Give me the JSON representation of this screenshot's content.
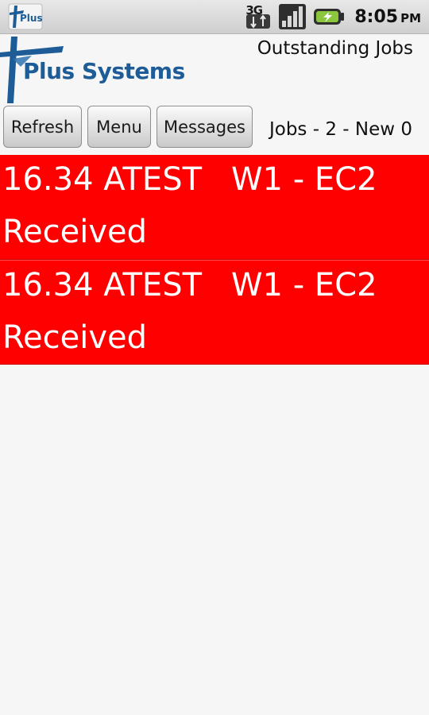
{
  "status_bar": {
    "notification_icon_text": "Plus",
    "network_type": "3G",
    "time": "8:05",
    "ampm": "PM",
    "icons": [
      "plus-notification-icon",
      "3g-data-icon",
      "signal-strength-icon",
      "battery-charging-icon"
    ]
  },
  "header": {
    "logo_text": "Plus Systems",
    "screen_title": "Outstanding Jobs"
  },
  "toolbar": {
    "refresh_label": "Refresh",
    "menu_label": "Menu",
    "messages_label": "Messages",
    "jobs_summary": "Jobs - 2 - New 0"
  },
  "jobs": [
    {
      "id_name": "16.34 ATEST",
      "route": "W1 - EC2",
      "status": "Received"
    },
    {
      "id_name": "16.34 ATEST",
      "route": "W1 - EC2",
      "status": "Received"
    }
  ],
  "colors": {
    "job_row_background": "#fe0000",
    "job_text": "#ffffff",
    "logo_blue": "#1d5c97",
    "battery_green": "#8cc63f"
  }
}
